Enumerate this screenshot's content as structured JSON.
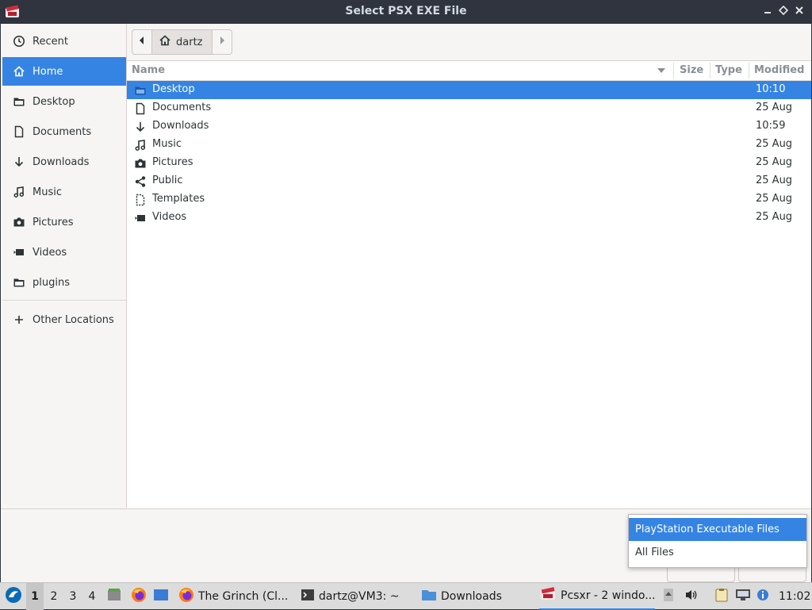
{
  "titlebar": {
    "title": "Select PSX EXE File",
    "minimize": "▁",
    "restore": "◇",
    "close": "✕"
  },
  "sidebar": {
    "items": [
      {
        "label": "Recent",
        "icon": "clock-icon",
        "active": false
      },
      {
        "label": "Home",
        "icon": "home-icon",
        "active": true
      },
      {
        "label": "Desktop",
        "icon": "folder-icon",
        "active": false
      },
      {
        "label": "Documents",
        "icon": "document-icon",
        "active": false
      },
      {
        "label": "Downloads",
        "icon": "download-icon",
        "active": false
      },
      {
        "label": "Music",
        "icon": "music-icon",
        "active": false
      },
      {
        "label": "Pictures",
        "icon": "camera-icon",
        "active": false
      },
      {
        "label": "Videos",
        "icon": "video-icon",
        "active": false
      },
      {
        "label": "plugins",
        "icon": "folder-icon",
        "active": false
      }
    ],
    "other_locations": "Other Locations"
  },
  "pathbar": {
    "crumb": "dartz"
  },
  "filelist": {
    "columns": {
      "name": "Name",
      "size": "Size",
      "type": "Type",
      "modified": "Modified"
    },
    "rows": [
      {
        "name": "Desktop",
        "icon": "folder-icon",
        "modified": "10:10",
        "selected": true
      },
      {
        "name": "Documents",
        "icon": "document-icon",
        "modified": "25 Aug",
        "selected": false
      },
      {
        "name": "Downloads",
        "icon": "download-icon",
        "modified": "10:59",
        "selected": false
      },
      {
        "name": "Music",
        "icon": "music-icon",
        "modified": "25 Aug",
        "selected": false
      },
      {
        "name": "Pictures",
        "icon": "camera-icon",
        "modified": "25 Aug",
        "selected": false
      },
      {
        "name": "Public",
        "icon": "share-icon",
        "modified": "25 Aug",
        "selected": false
      },
      {
        "name": "Templates",
        "icon": "template-icon",
        "modified": "25 Aug",
        "selected": false
      },
      {
        "name": "Videos",
        "icon": "video-icon",
        "modified": "25 Aug",
        "selected": false
      }
    ]
  },
  "filter_popup": {
    "options": [
      "PlayStation Executable Files",
      "All Files"
    ],
    "highlighted": 0
  },
  "taskbar": {
    "workspaces": [
      "1",
      "2",
      "3",
      "4"
    ],
    "current_workspace": "1",
    "tasks": [
      {
        "label": "The Grinch (Cl...",
        "icon": "firefox-icon"
      },
      {
        "label": "dartz@VM3: ~",
        "icon": "terminal-icon"
      },
      {
        "label": "Downloads",
        "icon": "folder-icon"
      },
      {
        "label": "Pcsxr - 2 windo...",
        "icon": "pcsxr-icon"
      }
    ],
    "clock": "11:02"
  },
  "colors": {
    "accent": "#3584e4",
    "titlebar": "#2f343f",
    "window_bg": "#f6f5f4"
  }
}
